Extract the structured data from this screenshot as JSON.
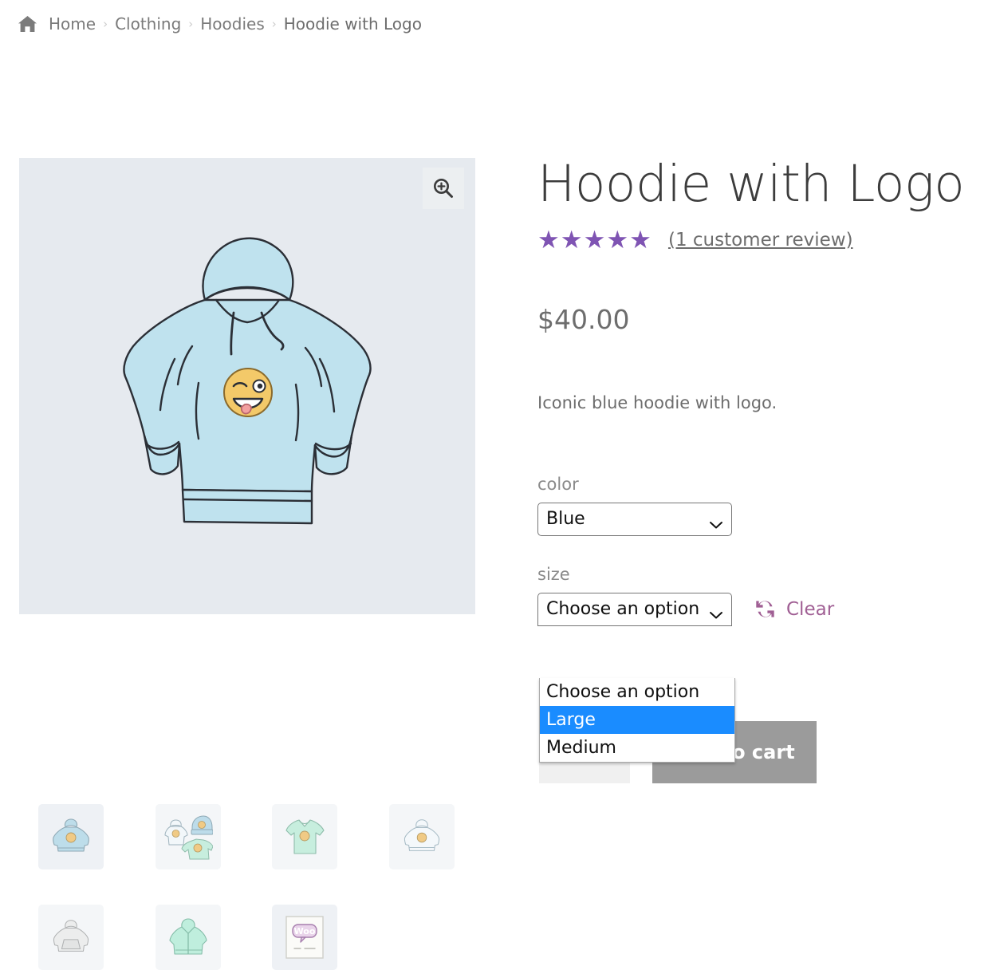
{
  "breadcrumb": {
    "home_icon": "home-icon",
    "separator": "›",
    "items": [
      {
        "label": "Home",
        "current": false
      },
      {
        "label": "Clothing",
        "current": false
      },
      {
        "label": "Hoodies",
        "current": false
      },
      {
        "label": "Hoodie with Logo",
        "current": true
      }
    ]
  },
  "gallery": {
    "zoom_icon": "magnifier-plus-icon",
    "main_image_alt": "Blue hoodie with winking emoji logo",
    "background_color": "#e6eaef",
    "thumbnails": [
      {
        "alt": "Blue hoodie with logo",
        "kind": "hoodie-blue"
      },
      {
        "alt": "Hoodie, beanie and t-shirt group",
        "kind": "group"
      },
      {
        "alt": "Green t-shirt with logo",
        "kind": "tshirt-green"
      },
      {
        "alt": "White hoodie with logo",
        "kind": "hoodie-white"
      },
      {
        "alt": "Grey hoodie with logo",
        "kind": "hoodie-grey"
      },
      {
        "alt": "Green zip hoodie",
        "kind": "hoodie-zip-green"
      },
      {
        "alt": "Woo logo poster",
        "kind": "woo-poster"
      }
    ]
  },
  "product": {
    "title": "Hoodie with Logo",
    "stars": "★★★★★",
    "star_count": 5,
    "star_color": "#7f54b3",
    "review_link": "(1 customer review)",
    "price": "$40.00",
    "short_description": "Iconic blue hoodie with logo."
  },
  "variations": {
    "color": {
      "label": "color",
      "selected": "Blue",
      "options": [
        "Blue"
      ]
    },
    "size": {
      "label": "size",
      "selected": "Choose an option",
      "expanded": true,
      "options": [
        {
          "label": "Choose an option",
          "highlighted": false
        },
        {
          "label": "Large",
          "highlighted": true
        },
        {
          "label": "Medium",
          "highlighted": false
        }
      ]
    },
    "clear": {
      "label": "Clear",
      "icon": "refresh-icon",
      "color": "#a05f94"
    }
  },
  "cart": {
    "quantity_value": "",
    "quantity_placeholder": "",
    "add_to_cart_label": "Add to cart",
    "add_to_cart_disabled": true,
    "add_to_cart_color": "#9b9b9b"
  }
}
